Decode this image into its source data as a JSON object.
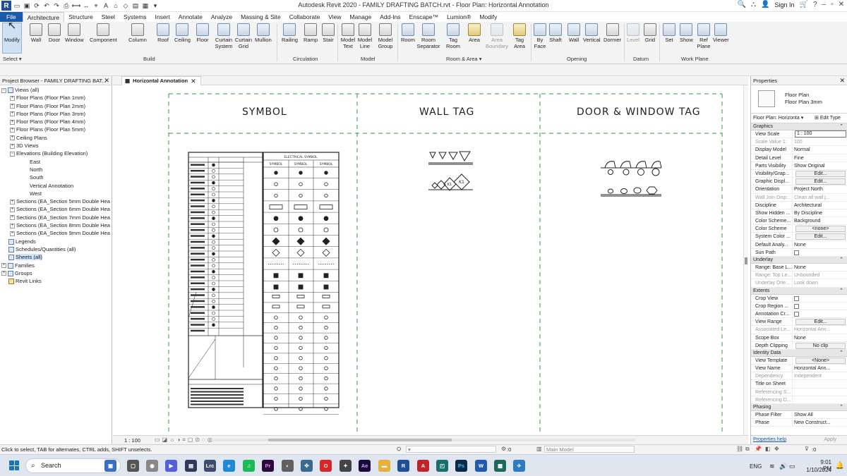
{
  "window": {
    "title": "Autodesk Revit 2020 - FAMILY DRAFTING BATCH.rvt - Floor Plan: Horizontal Annotation",
    "app_icon": "R",
    "sign_in": "Sign In"
  },
  "tabs": [
    {
      "label": "File"
    },
    {
      "label": "Architecture"
    },
    {
      "label": "Structure"
    },
    {
      "label": "Steel"
    },
    {
      "label": "Systems"
    },
    {
      "label": "Insert"
    },
    {
      "label": "Annotate"
    },
    {
      "label": "Analyze"
    },
    {
      "label": "Massing & Site"
    },
    {
      "label": "Collaborate"
    },
    {
      "label": "View"
    },
    {
      "label": "Manage"
    },
    {
      "label": "Add-Ins"
    },
    {
      "label": "Enscape™"
    },
    {
      "label": "Lumion®"
    },
    {
      "label": "Modify"
    }
  ],
  "ribbon": {
    "tools": [
      {
        "label": "Modify",
        "icon": "cursor-icon"
      },
      {
        "label": "Wall"
      },
      {
        "label": "Door"
      },
      {
        "label": "Window"
      },
      {
        "label": "Component"
      },
      {
        "label": "Column"
      },
      {
        "label": "Roof"
      },
      {
        "label": "Ceiling"
      },
      {
        "label": "Floor"
      },
      {
        "label": "Curtain System"
      },
      {
        "label": "Curtain Grid"
      },
      {
        "label": "Mullion"
      },
      {
        "label": "Railing"
      },
      {
        "label": "Ramp"
      },
      {
        "label": "Stair"
      },
      {
        "label": "Model Text"
      },
      {
        "label": "Model Line"
      },
      {
        "label": "Model Group"
      },
      {
        "label": "Room"
      },
      {
        "label": "Room Separator"
      },
      {
        "label": "Tag Room"
      },
      {
        "label": "Area"
      },
      {
        "label": "Area Boundary"
      },
      {
        "label": "Tag Area"
      },
      {
        "label": "By Face"
      },
      {
        "label": "Shaft"
      },
      {
        "label": "Wall"
      },
      {
        "label": "Vertical"
      },
      {
        "label": "Dormer"
      },
      {
        "label": "Level"
      },
      {
        "label": "Grid"
      },
      {
        "label": "Set"
      },
      {
        "label": "Show"
      },
      {
        "label": "Ref Plane"
      },
      {
        "label": "Viewer"
      }
    ],
    "groups": [
      {
        "label": "Select ▾"
      },
      {
        "label": "Build"
      },
      {
        "label": "Circulation"
      },
      {
        "label": "Model"
      },
      {
        "label": "Room & Area ▾"
      },
      {
        "label": "Opening"
      },
      {
        "label": "Datum"
      },
      {
        "label": "Work Plane"
      }
    ]
  },
  "project_browser": {
    "title": "Project Browser - FAMILY DRAFTING BAT...",
    "items": [
      {
        "label": "Views (all)"
      },
      {
        "label": "Floor Plans (Floor Plan 1mm)"
      },
      {
        "label": "Floor Plans (Floor Plan 2mm)"
      },
      {
        "label": "Floor Plans (Floor Plan 3mm)"
      },
      {
        "label": "Floor Plans (Floor Plan 4mm)"
      },
      {
        "label": "Floor Plans (Floor Plan 5mm)"
      },
      {
        "label": "Ceiling Plans"
      },
      {
        "label": "3D Views"
      },
      {
        "label": "Elevations (Building Elevation)"
      },
      {
        "label": "East"
      },
      {
        "label": "North"
      },
      {
        "label": "South"
      },
      {
        "label": "Vertical Annotation"
      },
      {
        "label": "West"
      },
      {
        "label": "Sections (EA_Section 5mm Double Hea"
      },
      {
        "label": "Sections (EA_Section 6mm Double Hea"
      },
      {
        "label": "Sections (EA_Section 7mm Double Hea"
      },
      {
        "label": "Sections (EA_Section 8mm Double Hea"
      },
      {
        "label": "Sections (EA_Section 9mm Double Hea"
      },
      {
        "label": "Legends"
      },
      {
        "label": "Schedules/Quantities (all)"
      },
      {
        "label": "Sheets (all)"
      },
      {
        "label": "Families"
      },
      {
        "label": "Groups"
      },
      {
        "label": "Revit Links"
      }
    ]
  },
  "view": {
    "tab_title": "Horizontal Annotation",
    "headings": [
      "SYMBOL",
      "WALL TAG",
      "DOOR & WINDOW TAG"
    ],
    "legend_header": "ELECTRICAL SYMBOL",
    "legend_cols": [
      "SYMBOL",
      "SYMBOL",
      "SYMBOL"
    ],
    "scale": "1 : 100",
    "wall_tags": [
      "K1",
      "K1"
    ]
  },
  "properties": {
    "title": "Properties",
    "type_line1": "Floor Plan",
    "type_line2": "Floor Plan 3mm",
    "selector": "Floor Plan: Horizonta",
    "edit_type": "Edit Type",
    "sections": [
      {
        "name": "Graphics",
        "rows": [
          {
            "k": "View Scale",
            "v": "1 : 100",
            "kind": "box"
          },
          {
            "k": "Scale Value 1:",
            "v": "100",
            "dim": true
          },
          {
            "k": "Display Model",
            "v": "Normal"
          },
          {
            "k": "Detail Level",
            "v": "Fine"
          },
          {
            "k": "Parts Visibility",
            "v": "Show Original"
          },
          {
            "k": "Visibility/Grap...",
            "v": "Edit...",
            "kind": "btn"
          },
          {
            "k": "Graphic Displ...",
            "v": "Edit...",
            "kind": "btn"
          },
          {
            "k": "Orientation",
            "v": "Project North"
          },
          {
            "k": "Wall Join Disp...",
            "v": "Clean all wall j...",
            "dim": true
          },
          {
            "k": "Discipline",
            "v": "Architectural"
          },
          {
            "k": "Show Hidden ...",
            "v": "By Discipline"
          },
          {
            "k": "Color Scheme...",
            "v": "Background"
          },
          {
            "k": "Color Scheme",
            "v": "<none>",
            "kind": "btn"
          },
          {
            "k": "System Color ...",
            "v": "Edit...",
            "kind": "btn"
          },
          {
            "k": "Default Analy...",
            "v": "None"
          },
          {
            "k": "Sun Path",
            "v": "",
            "kind": "chk"
          }
        ]
      },
      {
        "name": "Underlay",
        "rows": [
          {
            "k": "Range: Base L...",
            "v": "None"
          },
          {
            "k": "Range: Top Le...",
            "v": "Unbounded",
            "dim": true
          },
          {
            "k": "Underlay Orie...",
            "v": "Look down",
            "dim": true
          }
        ]
      },
      {
        "name": "Extents",
        "rows": [
          {
            "k": "Crop View",
            "v": "",
            "kind": "chk"
          },
          {
            "k": "Crop Region ...",
            "v": "",
            "kind": "chk"
          },
          {
            "k": "Annotation Cr...",
            "v": "",
            "kind": "chk"
          },
          {
            "k": "View Range",
            "v": "Edit...",
            "kind": "btn"
          },
          {
            "k": "Associated Le...",
            "v": "Horizontal Ann...",
            "dim": true
          },
          {
            "k": "Scope Box",
            "v": "None"
          },
          {
            "k": "Depth Clipping",
            "v": "No clip",
            "kind": "btn"
          }
        ]
      },
      {
        "name": "Identity Data",
        "rows": [
          {
            "k": "View Template",
            "v": "<None>",
            "kind": "btn"
          },
          {
            "k": "View Name",
            "v": "Horizontal Ann..."
          },
          {
            "k": "Dependency",
            "v": "Independent",
            "dim": true
          },
          {
            "k": "Title on Sheet",
            "v": ""
          },
          {
            "k": "Referencing S...",
            "v": "",
            "dim": true
          },
          {
            "k": "Referencing D...",
            "v": "",
            "dim": true
          }
        ]
      },
      {
        "name": "Phasing",
        "rows": [
          {
            "k": "Phase Filter",
            "v": "Show All"
          },
          {
            "k": "Phase",
            "v": "New Construct..."
          }
        ]
      }
    ],
    "help": "Properties help",
    "apply": "Apply"
  },
  "status": {
    "message": "Click to select, TAB for alternates, CTRL adds, SHIFT unselects.",
    "workset_count": ":0",
    "model": "Main Model",
    "select_count": ":0"
  },
  "taskbar": {
    "search": "Search",
    "lang": "ENG",
    "time": "9:01 PM",
    "date": "1/10/2024"
  }
}
